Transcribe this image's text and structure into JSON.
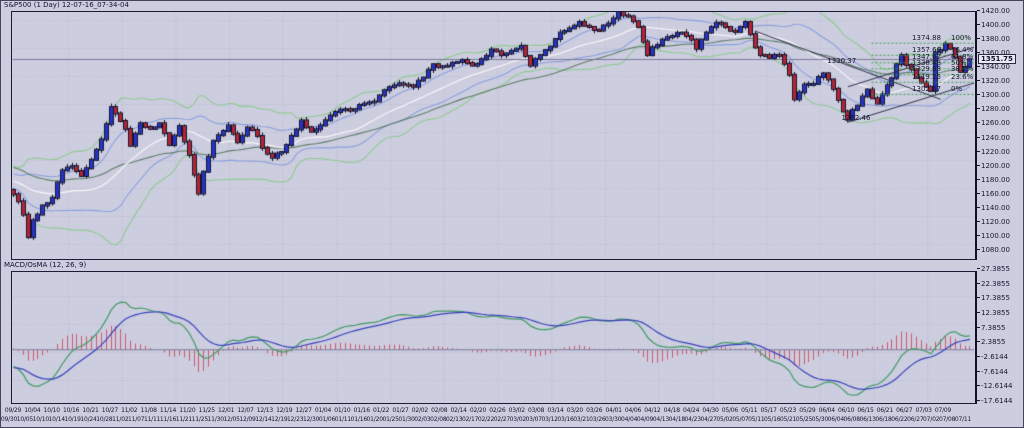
{
  "window": {
    "title": "S&P500 (1 Day) 12-07-16_07-34-04"
  },
  "price_pane": {
    "current_price_label": "1351.75"
  },
  "macd_pane": {
    "title": "MACD/OsMA (12, 26, 9)"
  },
  "colors": {
    "background": "#cdcde0",
    "grid": "#b6b6cc",
    "panel_border": "#1c1c38",
    "candle_up": "#2433c8",
    "candle_down": "#b42436",
    "candle_wick": "#14142a",
    "bollinger_outer": "#8ecb8e",
    "bollinger_inner": "#8aa0dc",
    "ma_fast": "#f2f2f4",
    "ma_slow": "#5f7f68",
    "current_price_line": "#7a7a9a",
    "macd_line": "#3f9b63",
    "signal_line": "#3742bb",
    "histogram": "#cf5868",
    "fib_line": "#3aa04a",
    "trend_line": "#30304a",
    "text": "#15152e"
  },
  "chart_data": {
    "type": "candlestick",
    "title": "S&P500 (1 Day)",
    "snapshot_id": "12-07-16_07-34-04",
    "price_axis_ticks": [
      "1420.00",
      "1400.00",
      "1380.00",
      "1360.00",
      "1340.00",
      "1320.00",
      "1300.00",
      "1280.00",
      "1260.00",
      "1240.00",
      "1220.00",
      "1200.00",
      "1180.00",
      "1160.00",
      "1140.00",
      "1120.00",
      "1100.00",
      "1080.00"
    ],
    "ylim": [
      1067,
      1424
    ],
    "current_price": 1351.75,
    "n_candles": 197,
    "close_anchors": [
      [
        0,
        1160
      ],
      [
        1,
        1150
      ],
      [
        2,
        1131
      ],
      [
        3,
        1099
      ],
      [
        4,
        1123
      ],
      [
        6,
        1144
      ],
      [
        8,
        1155
      ],
      [
        10,
        1194
      ],
      [
        12,
        1200
      ],
      [
        14,
        1186
      ],
      [
        16,
        1209
      ],
      [
        18,
        1238
      ],
      [
        20,
        1284
      ],
      [
        21,
        1275
      ],
      [
        23,
        1253
      ],
      [
        24,
        1229
      ],
      [
        26,
        1261
      ],
      [
        28,
        1253
      ],
      [
        30,
        1261
      ],
      [
        32,
        1230
      ],
      [
        34,
        1257
      ],
      [
        36,
        1216
      ],
      [
        37,
        1188
      ],
      [
        38,
        1161
      ],
      [
        39,
        1192
      ],
      [
        41,
        1236
      ],
      [
        42,
        1244
      ],
      [
        44,
        1258
      ],
      [
        46,
        1234
      ],
      [
        48,
        1255
      ],
      [
        50,
        1243
      ],
      [
        51,
        1226
      ],
      [
        53,
        1212
      ],
      [
        55,
        1220
      ],
      [
        57,
        1243
      ],
      [
        59,
        1265
      ],
      [
        61,
        1249
      ],
      [
        63,
        1258
      ],
      [
        65,
        1272
      ],
      [
        66,
        1277
      ],
      [
        68,
        1281
      ],
      [
        70,
        1281
      ],
      [
        72,
        1289
      ],
      [
        74,
        1292
      ],
      [
        76,
        1308
      ],
      [
        78,
        1315
      ],
      [
        80,
        1316
      ],
      [
        82,
        1313
      ],
      [
        84,
        1326
      ],
      [
        86,
        1345
      ],
      [
        88,
        1342
      ],
      [
        90,
        1347
      ],
      [
        92,
        1351
      ],
      [
        94,
        1343
      ],
      [
        96,
        1352
      ],
      [
        98,
        1366
      ],
      [
        100,
        1358
      ],
      [
        102,
        1364
      ],
      [
        104,
        1371
      ],
      [
        106,
        1343
      ],
      [
        108,
        1358
      ],
      [
        110,
        1370
      ],
      [
        112,
        1390
      ],
      [
        114,
        1396
      ],
      [
        116,
        1405
      ],
      [
        118,
        1398
      ],
      [
        120,
        1393
      ],
      [
        122,
        1403
      ],
      [
        124,
        1419
      ],
      [
        126,
        1413
      ],
      [
        128,
        1398
      ],
      [
        130,
        1358
      ],
      [
        131,
        1369
      ],
      [
        133,
        1380
      ],
      [
        135,
        1385
      ],
      [
        137,
        1390
      ],
      [
        139,
        1380
      ],
      [
        140,
        1367
      ],
      [
        142,
        1390
      ],
      [
        144,
        1404
      ],
      [
        146,
        1398
      ],
      [
        148,
        1391
      ],
      [
        150,
        1405
      ],
      [
        152,
        1369
      ],
      [
        153,
        1358
      ],
      [
        155,
        1354
      ],
      [
        157,
        1358
      ],
      [
        159,
        1330
      ],
      [
        160,
        1295
      ],
      [
        161,
        1305
      ],
      [
        162,
        1316
      ],
      [
        164,
        1317
      ],
      [
        166,
        1332
      ],
      [
        168,
        1310
      ],
      [
        170,
        1278
      ],
      [
        171,
        1266
      ],
      [
        172,
        1280
      ],
      [
        173,
        1286
      ],
      [
        175,
        1309
      ],
      [
        177,
        1289
      ],
      [
        179,
        1315
      ],
      [
        180,
        1325
      ],
      [
        181,
        1345
      ],
      [
        182,
        1358
      ],
      [
        183,
        1344
      ],
      [
        184,
        1338
      ],
      [
        185,
        1326
      ],
      [
        186,
        1319
      ],
      [
        187,
        1313
      ],
      [
        188,
        1307
      ],
      [
        189,
        1362
      ],
      [
        190,
        1365
      ],
      [
        191,
        1374
      ],
      [
        192,
        1367
      ],
      [
        193,
        1355
      ],
      [
        194,
        1334
      ],
      [
        195,
        1341
      ],
      [
        196,
        1352
      ]
    ],
    "indicators": {
      "bollinger": "BB(20): outer ±2σ green, inner ±1σ blue, SMA20 white",
      "slow_ma": "EMA(45) dark green"
    },
    "fibonacci": {
      "low": 1302.07,
      "high": 1374.88,
      "levels": [
        {
          "pct": "100%",
          "price": "1374.88",
          "value": 1374.88
        },
        {
          "pct": "76.4%",
          "price": "1357.66",
          "value": 1357.66
        },
        {
          "pct": "61.8%",
          "price": "1347.07",
          "value": 1347.07
        },
        {
          "pct": "50%",
          "price": "1338.48",
          "value": 1338.48
        },
        {
          "pct": "38.2%",
          "price": "1329.88",
          "value": 1329.88
        },
        {
          "pct": "23.6%",
          "price": "1319.25",
          "value": 1319.25
        },
        {
          "pct": "0%",
          "price": "1302.07",
          "value": 1302.07
        }
      ]
    },
    "annotations": [
      {
        "text": "1330.37",
        "index": 173,
        "price": 1330.37,
        "dx": -30,
        "dy": -17
      },
      {
        "text": "1262.46",
        "index": 171,
        "price": 1262.46,
        "dx": -6,
        "dy": -8
      }
    ],
    "trendlines": [
      {
        "name": "channel-lower",
        "i1": 171,
        "p1": 1262.5,
        "i2": 206,
        "p2": 1338
      },
      {
        "name": "channel-upper",
        "i1": 171,
        "p1": 1313,
        "i2": 206,
        "p2": 1389
      },
      {
        "name": "downtrend",
        "i1": 152,
        "p1": 1392,
        "i2": 190,
        "p2": 1295
      }
    ],
    "macd": {
      "title": "MACD/OsMA (12, 26, 9)",
      "params": [
        12,
        26,
        9
      ],
      "axis_ticks": [
        "27.3855",
        "22.3855",
        "17.3855",
        "12.3855",
        "7.3855",
        "2.3855",
        "-2.6144",
        "-7.6144",
        "-12.6144",
        "-17.6144"
      ]
    },
    "date_axis_row1": [
      "09/29",
      "10/04",
      "10/10",
      "10/16",
      "10/21",
      "10/27",
      "11/02",
      "11/08",
      "11/14",
      "11/20",
      "11/25",
      "12/01",
      "12/07",
      "12/13",
      "12/19",
      "12/27",
      "01/04",
      "01/10",
      "01/16",
      "01/22",
      "01/27",
      "02/02",
      "02/08",
      "02/14",
      "02/20",
      "02/26",
      "03/02",
      "03/08",
      "03/14",
      "03/20",
      "03/26",
      "04/01",
      "04/06",
      "04/12",
      "04/18",
      "04/24",
      "04/30",
      "05/06",
      "05/11",
      "05/17",
      "05/23",
      "05/29",
      "06/04",
      "06/10",
      "06/15",
      "06/21",
      "06/27",
      "07/03",
      "07/09"
    ],
    "date_axis_row2": [
      "09/30",
      "10/05",
      "10/10",
      "10/14",
      "10/19",
      "10/24",
      "10/28",
      "11/02",
      "11/07",
      "11/11",
      "11/16",
      "11/21",
      "11/25",
      "11/30",
      "12/05",
      "12/09",
      "12/14",
      "12/19",
      "12/23",
      "12/30",
      "01/06",
      "01/11",
      "01/16",
      "01/20",
      "01/25",
      "01/30",
      "02/03",
      "02/08",
      "02/13",
      "02/17",
      "02/22",
      "02/27",
      "03/02",
      "03/07",
      "03/12",
      "03/16",
      "03/21",
      "03/26",
      "03/30",
      "04/04",
      "04/09",
      "04/13",
      "04/18",
      "04/23",
      "04/27",
      "05/02",
      "05/07",
      "05/11",
      "05/16",
      "05/21",
      "05/25",
      "05/30",
      "06/04",
      "06/08",
      "06/13",
      "06/18",
      "06/22",
      "06/27",
      "07/02",
      "07/08",
      "07/11"
    ]
  }
}
